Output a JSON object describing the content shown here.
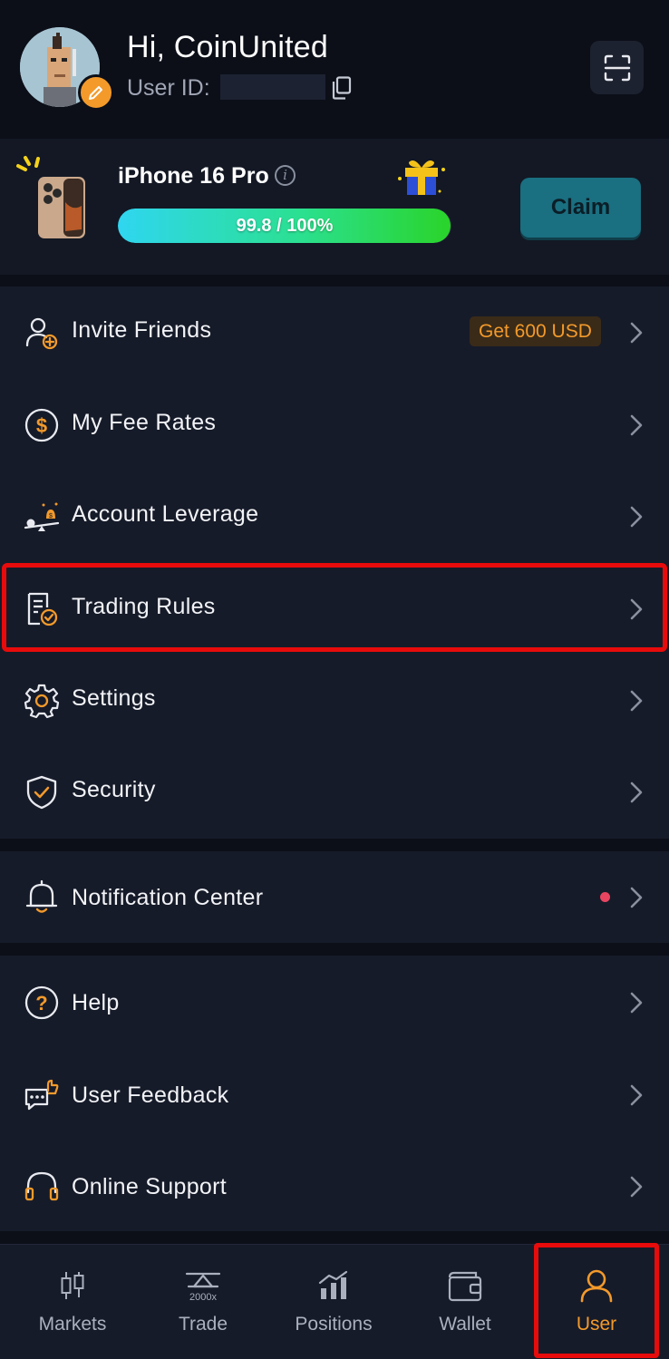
{
  "header": {
    "greeting": "Hi, CoinUnited",
    "user_id_label": "User ID:",
    "icons": [
      "avatar",
      "edit-icon",
      "copy-icon",
      "scan-icon"
    ]
  },
  "promo": {
    "title": "iPhone 16 Pro",
    "progress_text": "99.8 / 100%",
    "progress_fraction": 0.998,
    "claim_label": "Claim",
    "icons": [
      "phone-image",
      "info-icon",
      "gift-icon"
    ]
  },
  "menu": {
    "invite_friends": {
      "label": "Invite Friends",
      "badge": "Get 600 USD",
      "icon": "add-user-icon"
    },
    "fee_rates": {
      "label": "My Fee Rates",
      "icon": "dollar-coin-icon"
    },
    "leverage": {
      "label": "Account Leverage",
      "icon": "leverage-scale-icon"
    },
    "trading_rules": {
      "label": "Trading Rules",
      "icon": "document-check-icon"
    },
    "settings": {
      "label": "Settings",
      "icon": "gear-icon"
    },
    "security": {
      "label": "Security",
      "icon": "shield-check-icon"
    },
    "notifications": {
      "label": "Notification Center",
      "icon": "bell-icon"
    },
    "help": {
      "label": "Help",
      "icon": "question-icon"
    },
    "feedback": {
      "label": "User Feedback",
      "icon": "feedback-icon"
    },
    "support": {
      "label": "Online Support",
      "icon": "headset-icon"
    }
  },
  "tabbar": {
    "markets": "Markets",
    "trade": "Trade",
    "trade_icon_text": "2000x",
    "positions": "Positions",
    "wallet": "Wallet",
    "user": "User",
    "active": "User"
  },
  "colors": {
    "accent": "#f39a2b",
    "background": "#0c0f18",
    "card": "#161b29",
    "highlight": "#e80b0b",
    "notification_dot": "#e94561"
  }
}
